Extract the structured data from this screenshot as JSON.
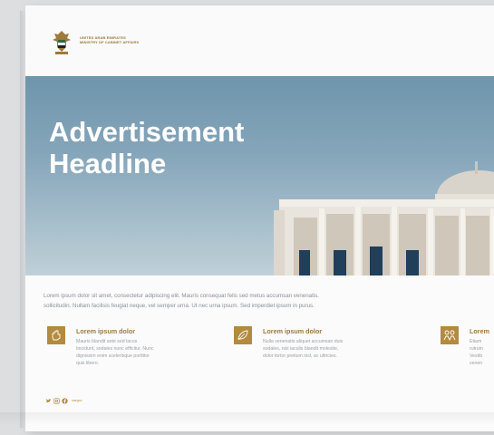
{
  "header": {
    "ministry_line1": "UNITED ARAB EMIRATES",
    "ministry_line2": "MINISTRY OF CABINET AFFAIRS"
  },
  "hero": {
    "title_line1": "Advertisement",
    "title_line2": "Headline"
  },
  "intro": {
    "line1": "Lorem ipsum dolor sit amet, consectetur adipiscing elit. Mauris consequat felis sed metus accumsan venenatis.",
    "line2": "sollicitudin. Nullam facilisis feugiat neque, vel semper urna. Ut nec urna ipsum. Sed imperdiet ipsum in purus."
  },
  "features": [
    {
      "icon": "hand-icon",
      "title": "Lorem ipsum dolor",
      "desc": [
        "Mauris blandit ante sed lacus",
        "tincidunt, sodales nunc efficitur. Nunc",
        "dignissim enim scelerisque porttitor",
        "quis libero."
      ]
    },
    {
      "icon": "leaf-icon",
      "title": "Lorem ipsum dolor",
      "desc": [
        "Nulla venenatis aliquet accumsan duis",
        "sodales, nisi iaculis blandit molestie,",
        "dolor tortor pretium nisl, ac ultricies."
      ]
    },
    {
      "icon": "people-icon",
      "title": "Lorem",
      "desc": [
        "Etiam",
        "rutrum",
        "Vestib",
        "venen"
      ]
    }
  ],
  "social": {
    "icons": [
      "twitter-icon",
      "instagram-icon",
      "facebook-icon"
    ],
    "handle": "uaegov"
  },
  "colors": {
    "accent": "#b38a3f",
    "hero_sky": "#7fa0b5",
    "title": "#ffffff"
  }
}
